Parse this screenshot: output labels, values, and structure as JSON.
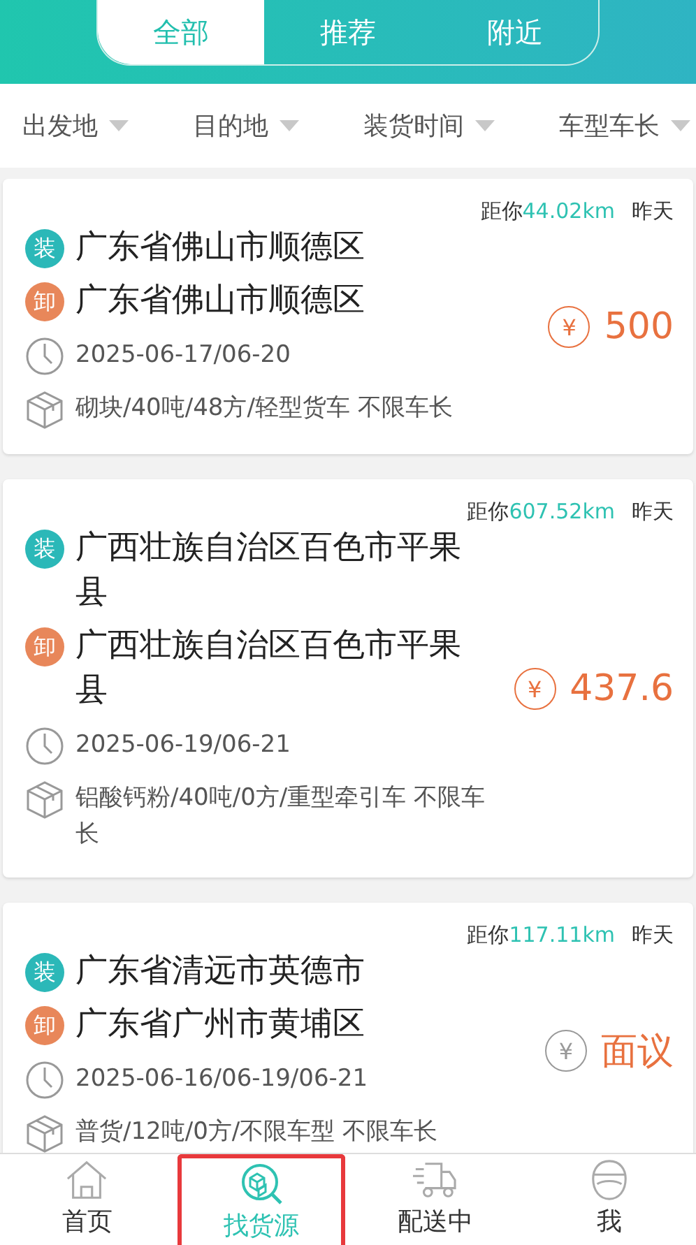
{
  "segments": [
    {
      "label": "全部",
      "selected": true
    },
    {
      "label": "推荐",
      "selected": false
    },
    {
      "label": "附近",
      "selected": false
    }
  ],
  "filters": [
    "出发地",
    "目的地",
    "装货时间",
    "车型车长"
  ],
  "cards": [
    {
      "distance_prefix": "距你",
      "distance": "44.02km",
      "time": "昨天",
      "load_tag": "装",
      "load": "广东省佛山市顺德区",
      "unload_tag": "卸",
      "unload": "广东省佛山市顺德区",
      "dates": "2025-06-17/06-20",
      "cargo": "砌块/40吨/48方/轻型货车 不限车长",
      "currency": "¥",
      "price": "500",
      "kind": "fixed"
    },
    {
      "distance_prefix": "距你",
      "distance": "607.52km",
      "time": "昨天",
      "load_tag": "装",
      "load": "广西壮族自治区百色市平果县",
      "unload_tag": "卸",
      "unload": "广西壮族自治区百色市平果县",
      "dates": "2025-06-19/06-21",
      "cargo": "铝酸钙粉/40吨/0方/重型牵引车 不限车长",
      "currency": "¥",
      "price": "437.6",
      "kind": "fixed"
    },
    {
      "distance_prefix": "距你",
      "distance": "117.11km",
      "time": "昨天",
      "load_tag": "装",
      "load": "广东省清远市英德市",
      "unload_tag": "卸",
      "unload": "广东省广州市黄埔区",
      "dates": "2025-06-16/06-19/06-21",
      "cargo": "普货/12吨/0方/不限车型 不限车长",
      "currency": "¥",
      "price": "面议",
      "kind": "negotiable"
    }
  ],
  "tabbar": [
    {
      "label": "首页",
      "kind": "home",
      "selected": false,
      "outlined": false
    },
    {
      "label": "找货源",
      "kind": "find",
      "selected": true,
      "outlined": true
    },
    {
      "label": "配送中",
      "kind": "truck",
      "selected": false,
      "outlined": false
    },
    {
      "label": "我",
      "kind": "user",
      "selected": false,
      "outlined": false
    }
  ]
}
